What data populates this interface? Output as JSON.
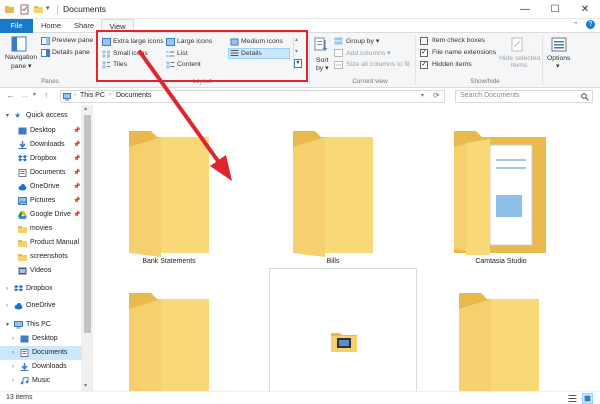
{
  "window": {
    "title": "Documents",
    "minimize": "—",
    "maximize": "☐",
    "close": "✕"
  },
  "tabs": {
    "file": "File",
    "home": "Home",
    "share": "Share",
    "view": "View"
  },
  "ribbon": {
    "panes": {
      "navigation": "Navigation",
      "navigation2": "pane ▾",
      "preview": "Preview pane",
      "details": "Details pane",
      "label": "Panes"
    },
    "layout": {
      "extra_large": "Extra large icons",
      "large": "Large icons",
      "medium": "Medium icons",
      "small": "Small icons",
      "list": "List",
      "details": "Details",
      "tiles": "Tiles",
      "content": "Content",
      "label": "Layout"
    },
    "current_view": {
      "sort": "Sort",
      "sort2": "by ▾",
      "group": "Group by ▾",
      "add_columns": "Add columns ▾",
      "size_columns": "Size all columns to fit",
      "label": "Current view"
    },
    "show_hide": {
      "item_check": "Item check boxes",
      "file_ext": "File name extensions",
      "hidden": "Hidden items",
      "hide_selected": "Hide selected",
      "hide_selected2": "items",
      "label": "Show/hide"
    },
    "options": {
      "label": "Options",
      "label2": "▾"
    }
  },
  "address": {
    "path1": "This PC",
    "path2": "Documents",
    "search_placeholder": "Search Documents"
  },
  "nav": {
    "quick_access": "Quick access",
    "items": [
      "Desktop",
      "Downloads",
      "Dropbox",
      "Documents",
      "OneDrive",
      "Pictures",
      "Google Drive",
      "movies",
      "Product Manual",
      "screenshots",
      "Videos"
    ],
    "dropbox": "Dropbox",
    "onedrive": "OneDrive",
    "this_pc": "This PC",
    "pc_items": [
      "Desktop",
      "Documents",
      "Downloads",
      "Music"
    ]
  },
  "content": {
    "folders": [
      "Bank Statements",
      "Bills",
      "Camtasia Studio"
    ]
  },
  "status": {
    "count": "13 items"
  },
  "colors": {
    "folder": "#f6d06e",
    "folder_dark": "#e9b94c",
    "accent": "#1979ca",
    "highlight": "#e0252e",
    "selected": "#cce8ff"
  }
}
